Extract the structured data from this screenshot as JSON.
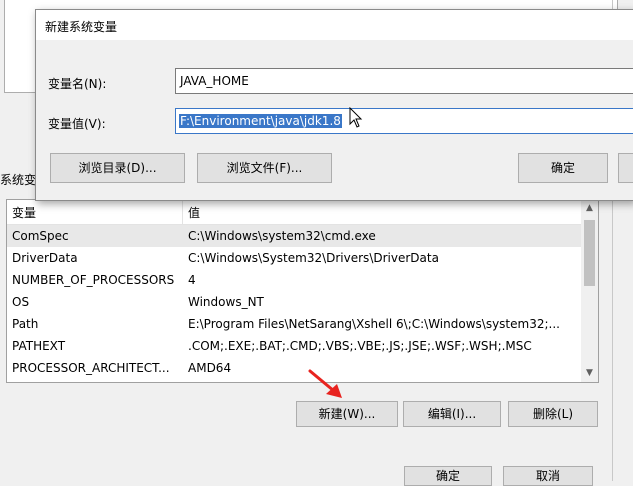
{
  "dialog": {
    "title": "新建系统变量",
    "name_label": "变量名(N):",
    "name_value": "JAVA_HOME",
    "value_label": "变量值(V):",
    "value_value": "F:\\Environment\\java\\jdk1.8",
    "browse_dir_button": "浏览目录(D)...",
    "browse_file_button": "浏览文件(F)...",
    "ok_button": "确定"
  },
  "background": {
    "section_label": "系统变",
    "list": {
      "columns": [
        "变量",
        "值"
      ],
      "rows": [
        {
          "name": "ComSpec",
          "value": "C:\\Windows\\system32\\cmd.exe"
        },
        {
          "name": "DriverData",
          "value": "C:\\Windows\\System32\\Drivers\\DriverData"
        },
        {
          "name": "NUMBER_OF_PROCESSORS",
          "value": "4"
        },
        {
          "name": "OS",
          "value": "Windows_NT"
        },
        {
          "name": "Path",
          "value": "E:\\Program Files\\NetSarang\\Xshell 6\\;C:\\Windows\\system32;..."
        },
        {
          "name": "PATHEXT",
          "value": ".COM;.EXE;.BAT;.CMD;.VBS;.VBE;.JS;.JSE;.WSF;.WSH;.MSC"
        },
        {
          "name": "PROCESSOR_ARCHITECT...",
          "value": "AMD64"
        }
      ]
    },
    "new_button": "新建(W)...",
    "edit_button": "编辑(I)...",
    "delete_button": "删除(L)",
    "ok_button": "确定",
    "cancel_button": "取消"
  },
  "colors": {
    "selection": "#3a77c8",
    "annotation_arrow": "#e8231f"
  }
}
